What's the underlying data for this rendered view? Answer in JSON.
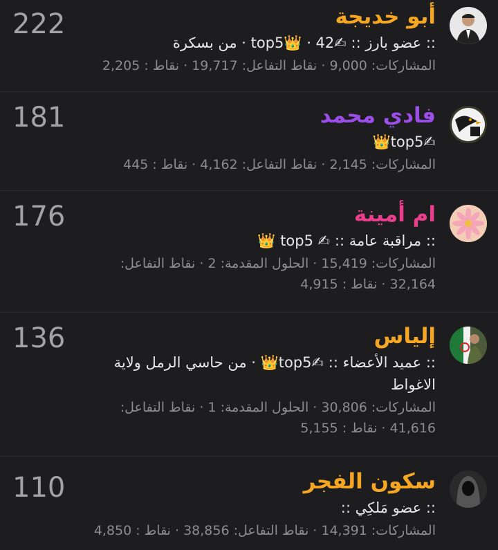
{
  "members": [
    {
      "name": "أبو خديجة",
      "name_color": "#f5a623",
      "score": "222",
      "meta": ":: عضو بارز :: ✍top5👑 · 42 · من بسكرة",
      "stats": "المشاركات: 9,000 · نقاط التفاعل: 19,717 · نقاط : 2,205",
      "avatar_icon": "man-in-suit-avatar"
    },
    {
      "name": "فادي محمد",
      "name_color": "#9b4ee8",
      "score": "181",
      "meta": "✍top5👑",
      "stats": "المشاركات: 2,145 · نقاط التفاعل: 4,162 · نقاط : 445",
      "avatar_icon": "eagle-avatar"
    },
    {
      "name": "ام أمينة",
      "name_color": "#e83e8c",
      "score": "176",
      "meta": ":: مراقبة عامة :: ✍ top5 👑",
      "stats": "المشاركات: 15,419 · الحلول المقدمة: 2 · نقاط التفاعل: 32,164 · نقاط : 4,915",
      "avatar_icon": "pink-flower-avatar"
    },
    {
      "name": "إلياس",
      "name_color": "#f5a623",
      "score": "136",
      "meta": ":: عميد الأعضاء :: ✍top5👑 · من حاسي الرمل ولاية الاغواط",
      "stats": "المشاركات: 30,806 · الحلول المقدمة: 1 · نقاط التفاعل: 41,616 · نقاط : 5,155",
      "avatar_icon": "soldier-flag-avatar"
    },
    {
      "name": "سكون الفجر",
      "name_color": "#f5a623",
      "score": "110",
      "meta": ":: عضو مَلكِي ::",
      "stats": "المشاركات: 14,391 · نقاط التفاعل: 38,856 · نقاط : 4,850",
      "avatar_icon": "hooded-figure-avatar"
    }
  ]
}
